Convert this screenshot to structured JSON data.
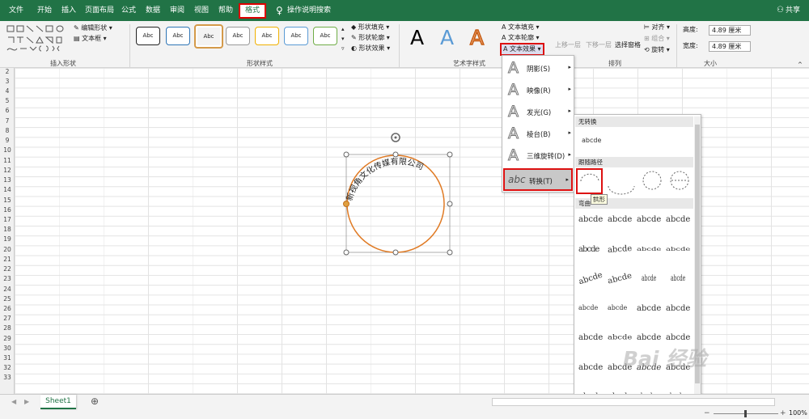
{
  "tabs": [
    "文件",
    "开始",
    "插入",
    "页面布局",
    "公式",
    "数据",
    "审阅",
    "视图",
    "帮助",
    "格式"
  ],
  "tell_me": "操作说明搜索",
  "share": "共享",
  "ribbon": {
    "edit_shape": "编辑形状",
    "text_box": "文本框",
    "group_insert": "插入形状",
    "group_styles": "形状样式",
    "group_wordart": "艺术字样式",
    "group_arrange": "排列",
    "group_size": "大小",
    "style_sample": "Abc",
    "fill": "形状填充",
    "outline": "形状轮廓",
    "effect": "形状效果",
    "text_fill": "文本填充",
    "text_outline": "文本轮廓",
    "text_effect": "文本效果",
    "bring_forward": "上移一层",
    "send_backward": "下移一层",
    "selection_pane": "选择窗格",
    "align": "对齐",
    "group": "组合",
    "rotate": "旋转",
    "height_label": "高度:",
    "height_value": "4.89 厘米",
    "width_label": "宽度:",
    "width_value": "4.89 厘米",
    "wordart_letter": "A"
  },
  "rows": [
    "2",
    "3",
    "4",
    "5",
    "6",
    "7",
    "8",
    "9",
    "10",
    "11",
    "12",
    "13",
    "14",
    "15",
    "16",
    "17",
    "18",
    "19",
    "20",
    "21",
    "22",
    "23",
    "24",
    "25",
    "26",
    "27",
    "28",
    "29",
    "30",
    "31",
    "32",
    "33"
  ],
  "shape_text": "新视角文化传媒有限公司",
  "text_effect_menu": [
    {
      "label": "阴影(S)"
    },
    {
      "label": "映像(R)"
    },
    {
      "label": "发光(G)"
    },
    {
      "label": "棱台(B)"
    },
    {
      "label": "三维旋转(D)"
    },
    {
      "label": "转换(T)"
    }
  ],
  "menu_letter": "A",
  "transform_icon": "abc",
  "gallery": {
    "no_transform": "无转换",
    "no_transform_sample": "abcde",
    "follow_path": "跟随路径",
    "warp": "弯曲",
    "tooltip": "拱形",
    "cell_text": "abcde"
  },
  "sheet_tab": "Sheet1",
  "zoom": "100%",
  "watermark": "Bai 经验",
  "colors": {
    "excel_green": "#217346",
    "shape_outline": "#e07b25",
    "highlight_red": "#dd1111"
  }
}
